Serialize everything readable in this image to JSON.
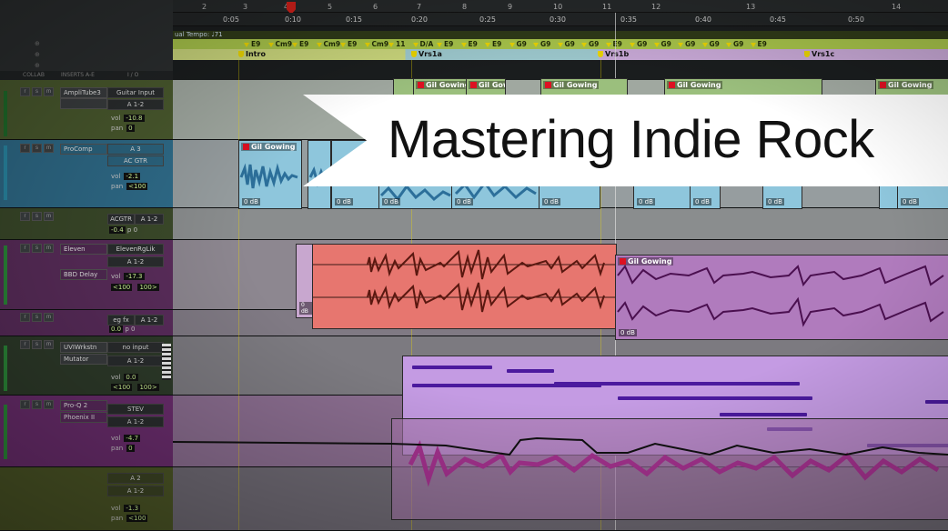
{
  "ruler": {
    "bars": [
      "2",
      "3",
      "4",
      "5",
      "6",
      "7",
      "8",
      "9",
      "10",
      "11",
      "12",
      "13",
      "14"
    ],
    "times": [
      "0:05",
      "0:10",
      "0:15",
      "0:20",
      "0:25",
      "0:30",
      "0:35",
      "0:40",
      "0:45",
      "0:50"
    ]
  },
  "tempo_label": "ual Tempo: ♩71",
  "chords": [
    "E9",
    "Cm9",
    "E9",
    "Cm9",
    "E9",
    "Cm9",
    "11",
    "D/A",
    "E9",
    "E9",
    "E9",
    "G9",
    "G9",
    "G9",
    "G9",
    "E9",
    "G9",
    "G9",
    "G9",
    "G9",
    "G9",
    "E9"
  ],
  "markers": [
    "Intro",
    "Vrs1a",
    "Vrs1b",
    "Vrs1c"
  ],
  "columns": {
    "collab": "COLLAB",
    "inserts": "INSERTS A-E",
    "io": "I / O"
  },
  "tracks": [
    {
      "insert1": "AmpliTube3",
      "insert2": "",
      "io_in": "Guitar Input",
      "io_out": "A 1-2",
      "vol": "-10.8",
      "pan": "0"
    },
    {
      "insert1": "ProComp",
      "insert2": "",
      "io_in": "A 3",
      "io_out": "AC GTR",
      "vol": "-2.1",
      "pan": "<100"
    },
    {
      "insert1": "",
      "insert2": "",
      "io_in": "ACGTR",
      "io_out": "A 1-2",
      "vol": "-0.4",
      "pan": "p 0"
    },
    {
      "insert1": "Eleven",
      "insert2": "BBD Delay",
      "io_in": "ElevenRgLik",
      "io_out": "A 1-2",
      "vol": "-17.3",
      "pan": "<100",
      "pan2": "100>"
    },
    {
      "insert1": "",
      "insert2": "",
      "io_in": "eg fx",
      "io_out": "A 1-2",
      "vol": "0.0",
      "pan": "p 0"
    },
    {
      "insert1": "UVIWrkstn",
      "insert2": "Mutator",
      "io_in": "no input",
      "io_out": "A 1-2",
      "vol": "0.0",
      "pan": "<100",
      "pan2": "100>"
    },
    {
      "insert1": "Pro-Q 2",
      "insert2": "Phoenix II",
      "io_in": "STEV",
      "io_out": "A 1-2",
      "vol": "-4.7",
      "pan": "0"
    },
    {
      "insert1": "",
      "insert2": "",
      "io_in": "A 2",
      "io_out": "A 1-2",
      "vol": "-1.3",
      "pan": "<100"
    }
  ],
  "clip_name": "Gil Gowing",
  "clip_gain": "0 dB",
  "vol_label": "vol",
  "pan_label": "pan",
  "title": "Mastering Indie Rock",
  "colors": {
    "blue_clip": "#8ec6dc",
    "red_clip": "#e7766f",
    "purple_clip": "#b07bbd",
    "midi": "#4b1a9e",
    "marker": "#e8d300"
  }
}
